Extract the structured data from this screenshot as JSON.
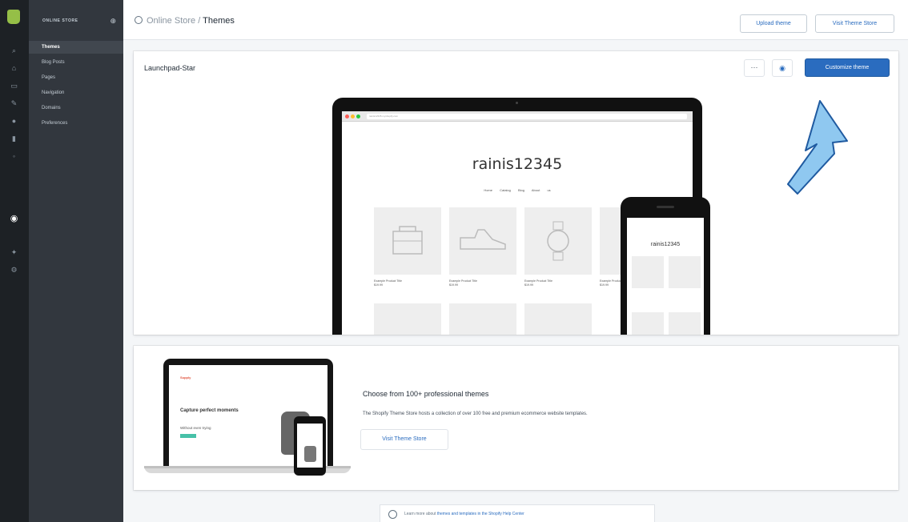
{
  "nav": {
    "title": "ONLINE STORE",
    "items": [
      {
        "label": "Themes",
        "active": true
      },
      {
        "label": "Blog Posts",
        "active": false
      },
      {
        "label": "Pages",
        "active": false
      },
      {
        "label": "Navigation",
        "active": false
      },
      {
        "label": "Domains",
        "active": false
      },
      {
        "label": "Preferences",
        "active": false
      }
    ]
  },
  "header": {
    "breadcrumb_parent": "Online Store",
    "separator": " / ",
    "breadcrumb_current": "Themes",
    "upload_label": "Upload theme",
    "visit_store_label": "Visit Theme Store"
  },
  "theme": {
    "name": "Launchpad-Star",
    "more_label": "···",
    "customize_label": "Customize theme",
    "preview": {
      "url": "rainis12345.myshopify.com",
      "store_name": "rainis12345",
      "nav_links": "Home Catalog Blog About us",
      "products": [
        {
          "title": "Example Product Title",
          "price": "$19.99"
        },
        {
          "title": "Example Product Title",
          "price": "$19.99"
        },
        {
          "title": "Example Product Title",
          "price": "$19.99"
        },
        {
          "title": "Example Product Title",
          "price": "$19.99"
        }
      ],
      "phone_store_name": "rainis12345"
    }
  },
  "promo": {
    "title": "Choose from 100+ professional themes",
    "description": "The Shopify Theme Store hosts a collection of over 100 free and premium ecommerce website templates.",
    "button_label": "Visit Theme Store",
    "illustration": {
      "brand": "Supply",
      "headline": "Capture perfect moments",
      "subline": "Without even trying"
    }
  },
  "footer": {
    "text": "Learn more about ",
    "link": "themes and templates in the Shopify Help Center"
  },
  "colors": {
    "accent": "#2a6cbf",
    "sidebar": "#32373e",
    "rail": "#1d2125",
    "annotation_arrow": "#8fc8f0"
  }
}
